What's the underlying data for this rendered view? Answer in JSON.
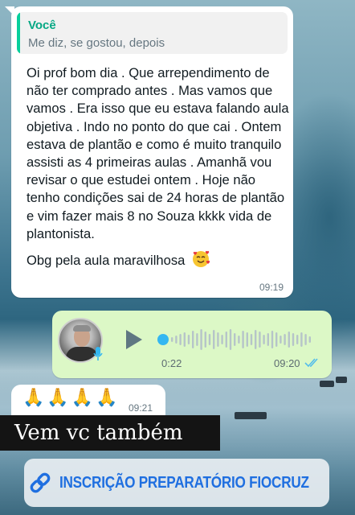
{
  "quoted_reply": {
    "author": "Você",
    "text": "Me diz, se gostou, depois"
  },
  "incoming_message": {
    "text": "Oi prof bom dia . Que arrependimento de não ter comprado antes . Mas vamos que vamos . Era isso que eu estava falando aula objetiva . Indo no ponto do que cai . Ontem estava de plantão e como é muito tranquilo assisti as 4 primeiras aulas . Amanhã vou revisar o que estudei ontem . Hoje não tenho condições sai de 24 horas de plantão e vim fazer mais 8 no Souza kkkk vida de plantonista.",
    "closing": "Obg pela aula maravilhosa",
    "emoji": "smiling-face-with-hearts",
    "time": "09:19"
  },
  "voice_message": {
    "duration": "0:22",
    "time": "09:20",
    "progress": 0,
    "status": "read",
    "accent_color": "#34b7f1"
  },
  "partial_message": {
    "emoji": "🙏🙏🙏🙏",
    "time": "09:21"
  },
  "story_caption": "Vem vc também",
  "link_sticker": {
    "label": "INSCRIÇÃO PREPARATÓRIO FIOCRUZ",
    "icon": "link-icon",
    "color": "#1f6fe0"
  }
}
